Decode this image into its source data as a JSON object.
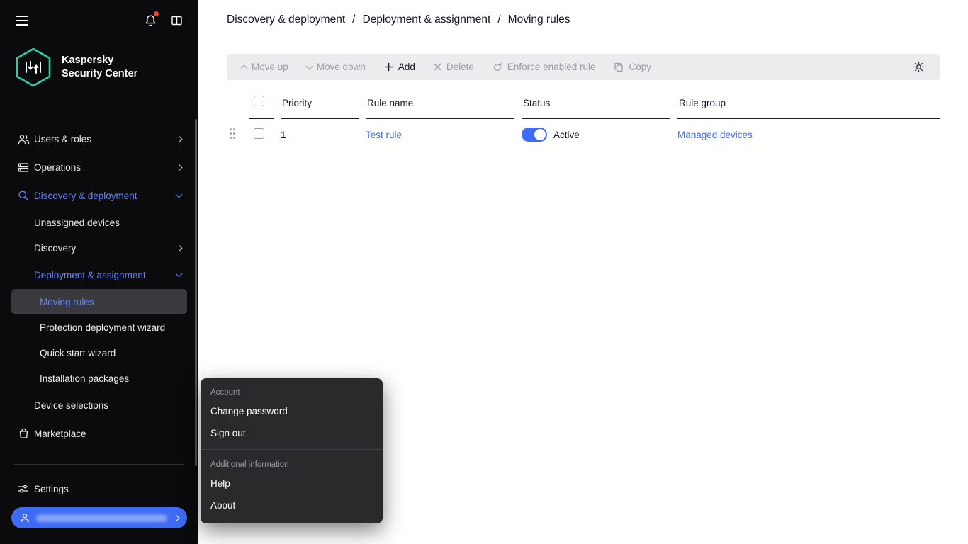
{
  "colors": {
    "accent": "#3d6bf5",
    "sidebar_active": "#6286f7",
    "logo_teal": "#27d2a4",
    "alert": "#e8442c"
  },
  "sidebar": {
    "brand_line1": "Kaspersky",
    "brand_line2": "Security Center",
    "items": [
      {
        "label": "Users & roles"
      },
      {
        "label": "Operations"
      },
      {
        "label": "Discovery & deployment"
      },
      {
        "label": "Unassigned devices"
      },
      {
        "label": "Discovery"
      },
      {
        "label": "Deployment & assignment"
      },
      {
        "label": "Moving rules"
      },
      {
        "label": "Protection deployment wizard"
      },
      {
        "label": "Quick start wizard"
      },
      {
        "label": "Installation packages"
      },
      {
        "label": "Device selections"
      },
      {
        "label": "Marketplace"
      },
      {
        "label": "Settings"
      }
    ]
  },
  "breadcrumb": {
    "sep": "/",
    "items": [
      "Discovery & deployment",
      "Deployment & assignment",
      "Moving rules"
    ]
  },
  "toolbar": {
    "buttons": [
      {
        "label": "Move up",
        "enabled": false
      },
      {
        "label": "Move down",
        "enabled": false
      },
      {
        "label": "Add",
        "enabled": true
      },
      {
        "label": "Delete",
        "enabled": false
      },
      {
        "label": "Enforce enabled rule",
        "enabled": false
      },
      {
        "label": "Copy",
        "enabled": false
      }
    ]
  },
  "table": {
    "headers": {
      "priority": "Priority",
      "rule_name": "Rule name",
      "status": "Status",
      "rule_group": "Rule group"
    },
    "row": {
      "priority": "1",
      "rule_name": "Test rule",
      "status_label": "Active",
      "status_on": true,
      "rule_group": "Managed devices"
    }
  },
  "menu": {
    "section1_label": "Account",
    "items1": [
      "Change password",
      "Sign out"
    ],
    "section2_label": "Additional information",
    "items2": [
      "Help",
      "About"
    ]
  }
}
